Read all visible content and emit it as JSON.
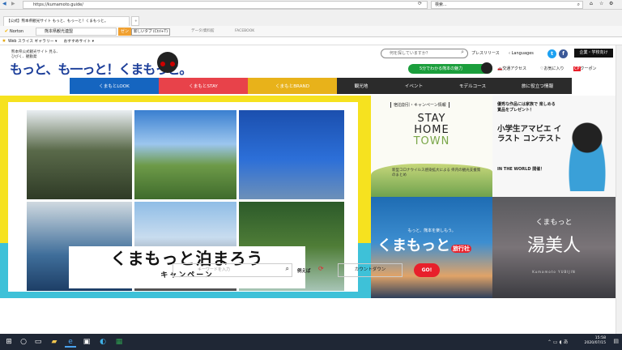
{
  "browser": {
    "url": "https://kumamoto.guide/",
    "search_placeholder": "検索...",
    "tabs": [
      {
        "label": "【公式】熊本県観光サイト もっと、もっーと！くまもっと。"
      },
      {
        "label": ""
      }
    ],
    "new_tab_tooltip": "新しいタブ (Ctrl+T)",
    "toolbar_items": [
      {
        "label": "Norton"
      },
      {
        "label": "熊本県観光連盟"
      },
      {
        "label": "データ/資料館"
      },
      {
        "label": "FACEBOOK"
      }
    ],
    "favorites": [
      {
        "label": "Web スライス ギャラリー ▾"
      },
      {
        "label": "おすすめサイト ▾"
      }
    ]
  },
  "site": {
    "logo_sub": "熊本県公式観光サイト 見る、ひびく、観動発",
    "logo_main": "もっと、も一っと！くまもっと。",
    "search_placeholder": "何を探していますか？",
    "press": "プレスリリース",
    "languages": "Languages",
    "corp_button": "企業・学校向け",
    "green_button": "5分でわかる熊本の魅力",
    "links": {
      "access": "交通アクセス",
      "favorites": "お気に入り",
      "coupon": "クーポン"
    },
    "nav": [
      {
        "label": "くまもとLOOK",
        "color": "#1565c0"
      },
      {
        "label": "くまもとSTAY",
        "color": "#e8424a"
      },
      {
        "label": "くまもとBRAND",
        "color": "#e8b21a"
      },
      {
        "label": "観光地",
        "color": "#2b2b2b"
      },
      {
        "label": "イベント",
        "color": "#2b2b2b"
      },
      {
        "label": "モデルコース",
        "color": "#2b2b2b"
      },
      {
        "label": "旅に役立つ情報",
        "color": "#2b2b2b"
      }
    ]
  },
  "hero": {
    "title": "くまもっと泊まろう",
    "subtitle": "キャンペーン"
  },
  "tiles": {
    "stay": {
      "tag": "宿泊割引・キャンペーン情報",
      "title1": "STAY",
      "title2": "HOME",
      "title3": "TOWN",
      "note": "新型コロナウイルス感染拡大による 県内の観光支援策のまとめ"
    },
    "contest": {
      "text1": "優秀な作品には家族で 楽しめる賞品をプレゼント！",
      "title": "小学生アマビエ イラスト コンテスト",
      "sub": "IN THE WORLD 開催！"
    },
    "travel": {
      "tag": "もっと、熊本を楽しもう。",
      "title": "くまもっと",
      "badge": "旅行社"
    },
    "yuubi": {
      "tag": "くまもっと",
      "title": "湯美人",
      "sub": "Kumamoto YUBIJIN"
    }
  },
  "bottom": {
    "keyword_placeholder": "キーワードを入力",
    "example": "例えば",
    "countdown": "カウントダウン",
    "go": "GO!"
  },
  "taskbar": {
    "time": "15:58",
    "date": "2020/07/15"
  }
}
